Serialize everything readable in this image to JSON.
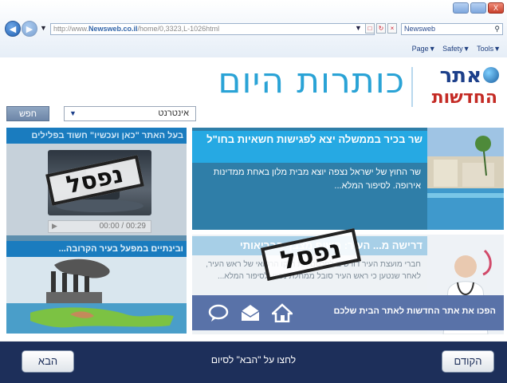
{
  "browser": {
    "address_prefix": "http://www.",
    "address_domain": "Newsweb.co.il",
    "address_path": "/home/0,3323,L-1026html",
    "search_value": "Newsweb",
    "cmd_page": "Page▼",
    "cmd_safety": "Safety▼",
    "cmd_tools": "Tools▼",
    "close_label": "X"
  },
  "site": {
    "logo_line1": "אתר",
    "logo_line2": "החדשות",
    "headline": "כותרות היום"
  },
  "search": {
    "button_label": "חפש",
    "selected_option": "אינטרנט"
  },
  "video": {
    "title": "בעל האתר \"כאן ועכשיו\" חשוד בפלילים",
    "time": "00:00 / 00:29",
    "stamp": "נפסל"
  },
  "illustration": {
    "title": "ובינתיים במפעל בעיר הקרובה..."
  },
  "article1": {
    "title": "שר בכיר בממשלה יצא לפגישות חשאיות בחו\"ל",
    "body": "שר החוץ של ישראל נצפה יוצא מבית מלון באחת ממדינות אירופה. לסיפור המלא..."
  },
  "article2": {
    "title": "דרישה מ... העיר: חשוף מצבך הבריאותי",
    "body": "חברי מועצת העיר דורשים לפרסם את תיקו הרפואי של ראש העיר, לאחר שנטען כי ראש העיר סובל ממחלת נפש. לסיפור המלא...",
    "stamp": "נפסל"
  },
  "promo": {
    "text": "הפכו את אתר החדשות לאתר הבית שלכם",
    "icons": [
      "chat-icon",
      "mail-icon",
      "home-icon"
    ]
  },
  "footer": {
    "next_label": "הבא",
    "prev_label": "הקודם",
    "message": "לחצו על \"הבא\" לסיום"
  },
  "colors": {
    "brand_blue": "#2aa3d6",
    "header_blue": "#26a9e3",
    "footer_navy": "#1d2f5a",
    "logo_red": "#c42a24"
  }
}
